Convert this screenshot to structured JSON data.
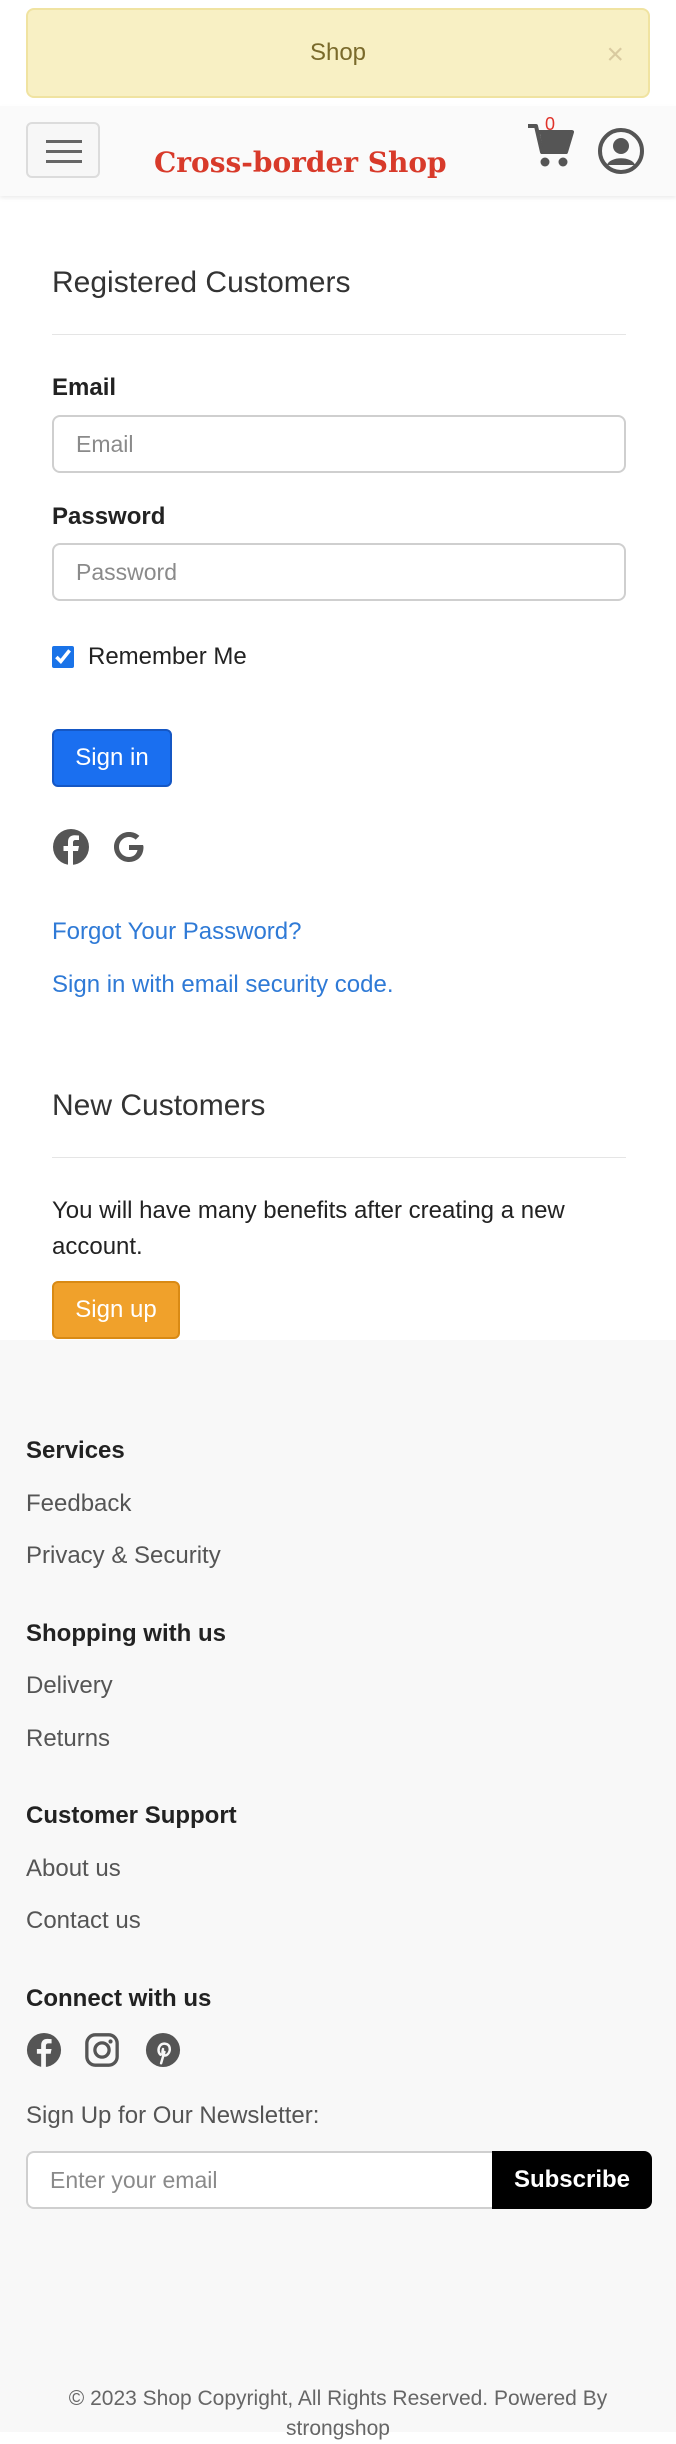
{
  "alert": {
    "text": "Shop",
    "close": "×"
  },
  "header": {
    "logo": "Cross-border Shop",
    "cart_count": "0"
  },
  "login": {
    "title": "Registered Customers",
    "email_label": "Email",
    "email_placeholder": "Email",
    "password_label": "Password",
    "password_placeholder": "Password",
    "remember_label": "Remember Me",
    "remember_checked": true,
    "signin_label": "Sign in",
    "forgot_link": "Forgot Your Password?",
    "email_code_link": "Sign in with email security code."
  },
  "register": {
    "title": "New Customers",
    "description": "You will have many benefits after creating a new account.",
    "signup_label": "Sign up"
  },
  "footer": {
    "groups": [
      {
        "title": "Services",
        "links": [
          "Feedback",
          "Privacy & Security"
        ]
      },
      {
        "title": "Shopping with us",
        "links": [
          "Delivery",
          "Returns"
        ]
      },
      {
        "title": "Customer Support",
        "links": [
          "About us",
          "Contact us"
        ]
      }
    ],
    "connect_title": "Connect with us",
    "social_icons": [
      "facebook-icon",
      "instagram-icon",
      "pinterest-icon"
    ],
    "newsletter_label": "Sign Up for Our Newsletter:",
    "newsletter_placeholder": "Enter your email",
    "subscribe_label": "Subscribe",
    "copyright": "© 2023 Shop Copyright, All Rights Reserved. Powered By strongshop"
  },
  "colors": {
    "brand": "#d83a2a",
    "primary": "#1a6ff0",
    "warning": "#f0a12b",
    "link": "#2f7ad6"
  }
}
